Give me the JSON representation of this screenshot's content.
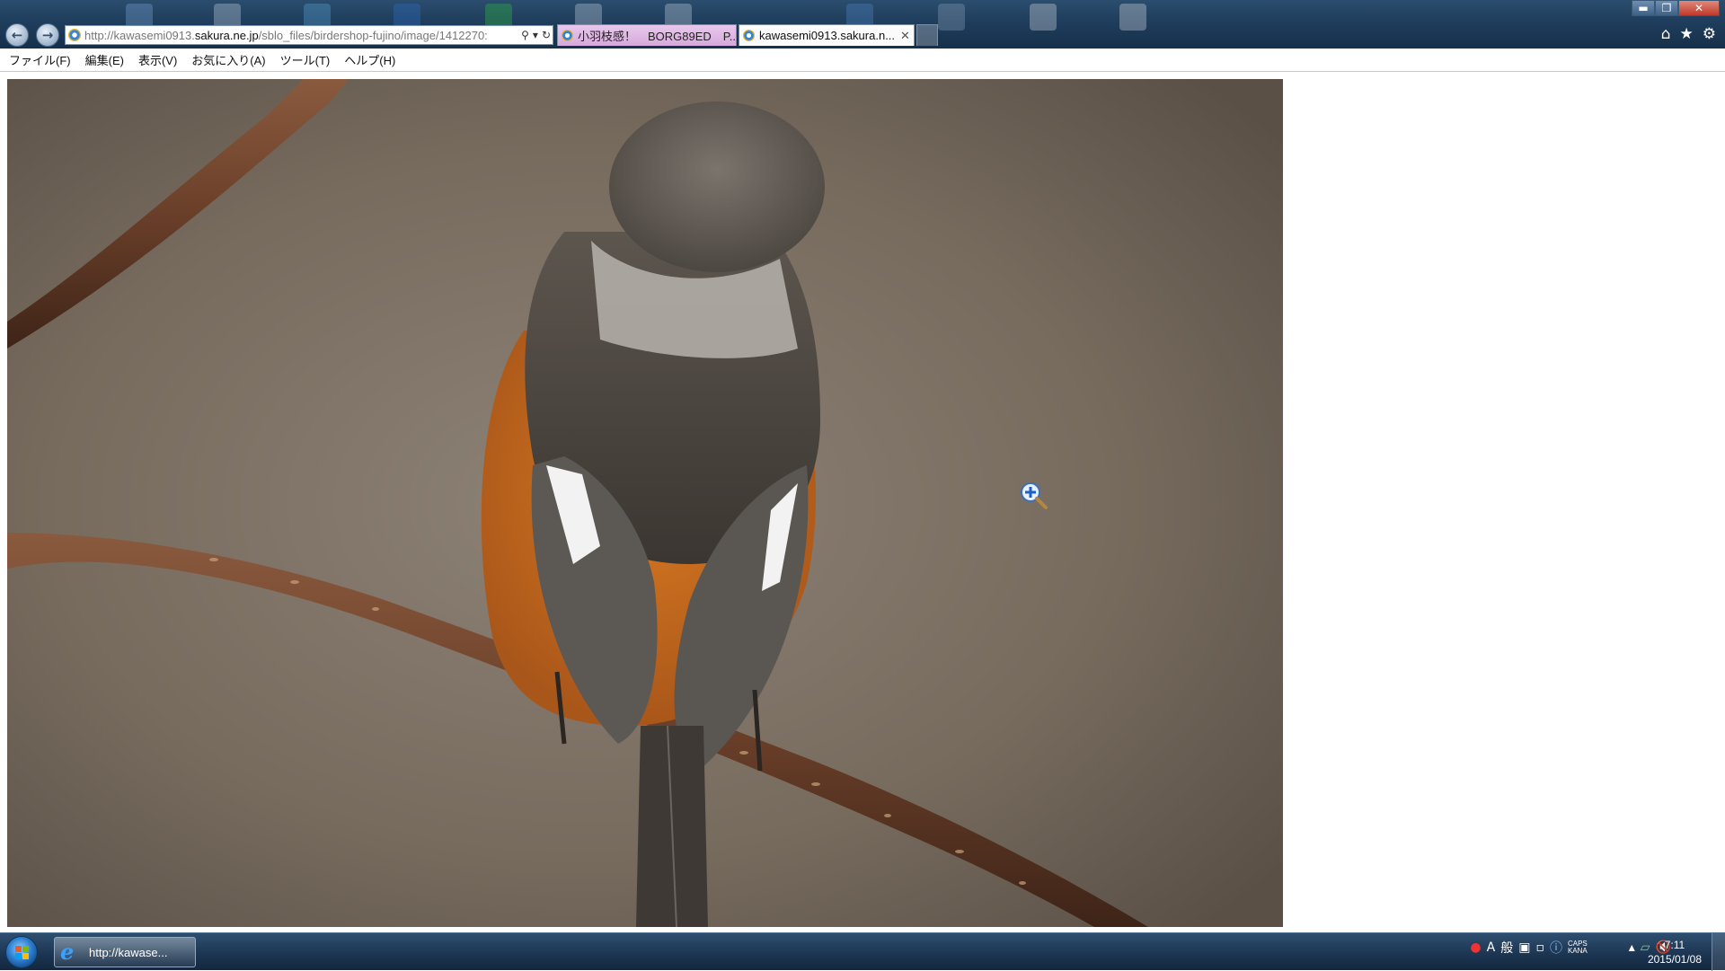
{
  "browser": {
    "address_prefix": "http://kawasemi0913.",
    "address_host": "sakura.ne.jp",
    "address_path": "/sblo_files/birdershop-fujino/image/1412270:",
    "tabs": [
      {
        "title": "小羽枝感！　BORG89ED　P..."
      },
      {
        "title": "kawasemi0913.sakura.n..."
      }
    ]
  },
  "menu": [
    {
      "label": "ファイル(F)"
    },
    {
      "label": "編集(E)"
    },
    {
      "label": "表示(V)"
    },
    {
      "label": "お気に入り(A)"
    },
    {
      "label": "ツール(T)"
    },
    {
      "label": "ヘルプ(H)"
    }
  ],
  "taskbar": {
    "ie_button_label": "http://kawase...",
    "ime_mode": "A",
    "ime_general": "般",
    "caps_label": "CAPS",
    "kana_label": "KANA",
    "clock_time": "7:11",
    "clock_date": "2015/01/08"
  },
  "icons": {
    "back": "back-arrow-icon",
    "forward": "forward-arrow-icon",
    "search": "search-icon",
    "refresh": "refresh-icon",
    "home": "home-icon",
    "favorites": "star-icon",
    "tools": "gear-icon",
    "zoom_cursor": "zoom-in-cursor-icon"
  },
  "colors": {
    "tab_active_bg": "#fbfbfb",
    "tab_inactive_bg": "#d6a9dc",
    "close_button": "#c0392b"
  }
}
